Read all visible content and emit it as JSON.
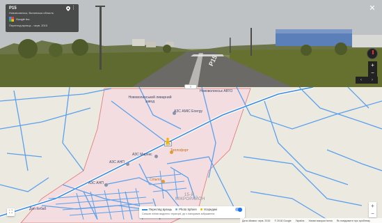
{
  "street_view": {
    "title": "P15",
    "subtitle": "Нововолинськ, Волинська область",
    "provider": "Google Inc.",
    "capture_date": "Перегляд вулиць - черв. 2015",
    "road_marking": "P15",
    "close_glyph": "✕",
    "zoom_in": "+",
    "zoom_out": "−",
    "nav_left": "‹",
    "nav_right": "›",
    "divider_label": "≡"
  },
  "map": {
    "labels": [
      {
        "name": "label-liyarny-zavod",
        "text": "Нововолинський ливарний завод",
        "cls": ""
      },
      {
        "name": "label-novovolynsk-avto",
        "text": "Нововолинськ АВТО",
        "cls": ""
      },
      {
        "name": "label-azs-energy",
        "text": "АЗС АМІС Energy",
        "cls": ""
      },
      {
        "name": "label-teplovyk",
        "text": "Теплофорт",
        "cls": "orange"
      },
      {
        "name": "label-azs-marex",
        "text": "АЗС Марекс",
        "cls": ""
      },
      {
        "name": "label-azs-ang",
        "text": "АЗС АНП",
        "cls": ""
      },
      {
        "name": "label-azs-anp-2",
        "text": "АЗС АНП",
        "cls": ""
      },
      {
        "name": "label-silpo",
        "text": "Сільпо",
        "cls": "orange"
      },
      {
        "name": "label-district",
        "text": "15-Й МІКРОРАЙОН",
        "cls": "big"
      },
      {
        "name": "label-don-kebab",
        "text": "Дон Кебаб",
        "cls": ""
      },
      {
        "name": "label-road-p15",
        "text": "P15",
        "cls": ""
      }
    ],
    "layers": {
      "street_view": "Перегляд вулиць",
      "photo_sphere": "Photo Sphere",
      "uploaded": "Усередині",
      "description": "Синьою лінією виділено території, де є панорамні зображення"
    },
    "fullscreen_glyph": "⛶",
    "zoom_in": "+",
    "zoom_out": "−",
    "footer": {
      "data": "Дата зйомки: черв. 2015",
      "copyright": "© 2018 Google",
      "country": "Україна",
      "terms": "Умови використання",
      "report": "Як повідомити про проблему"
    },
    "colors": {
      "area_fill": "#f2d9dc",
      "area_border": "#e57373",
      "streetview_blue": "#3b8be0"
    }
  }
}
